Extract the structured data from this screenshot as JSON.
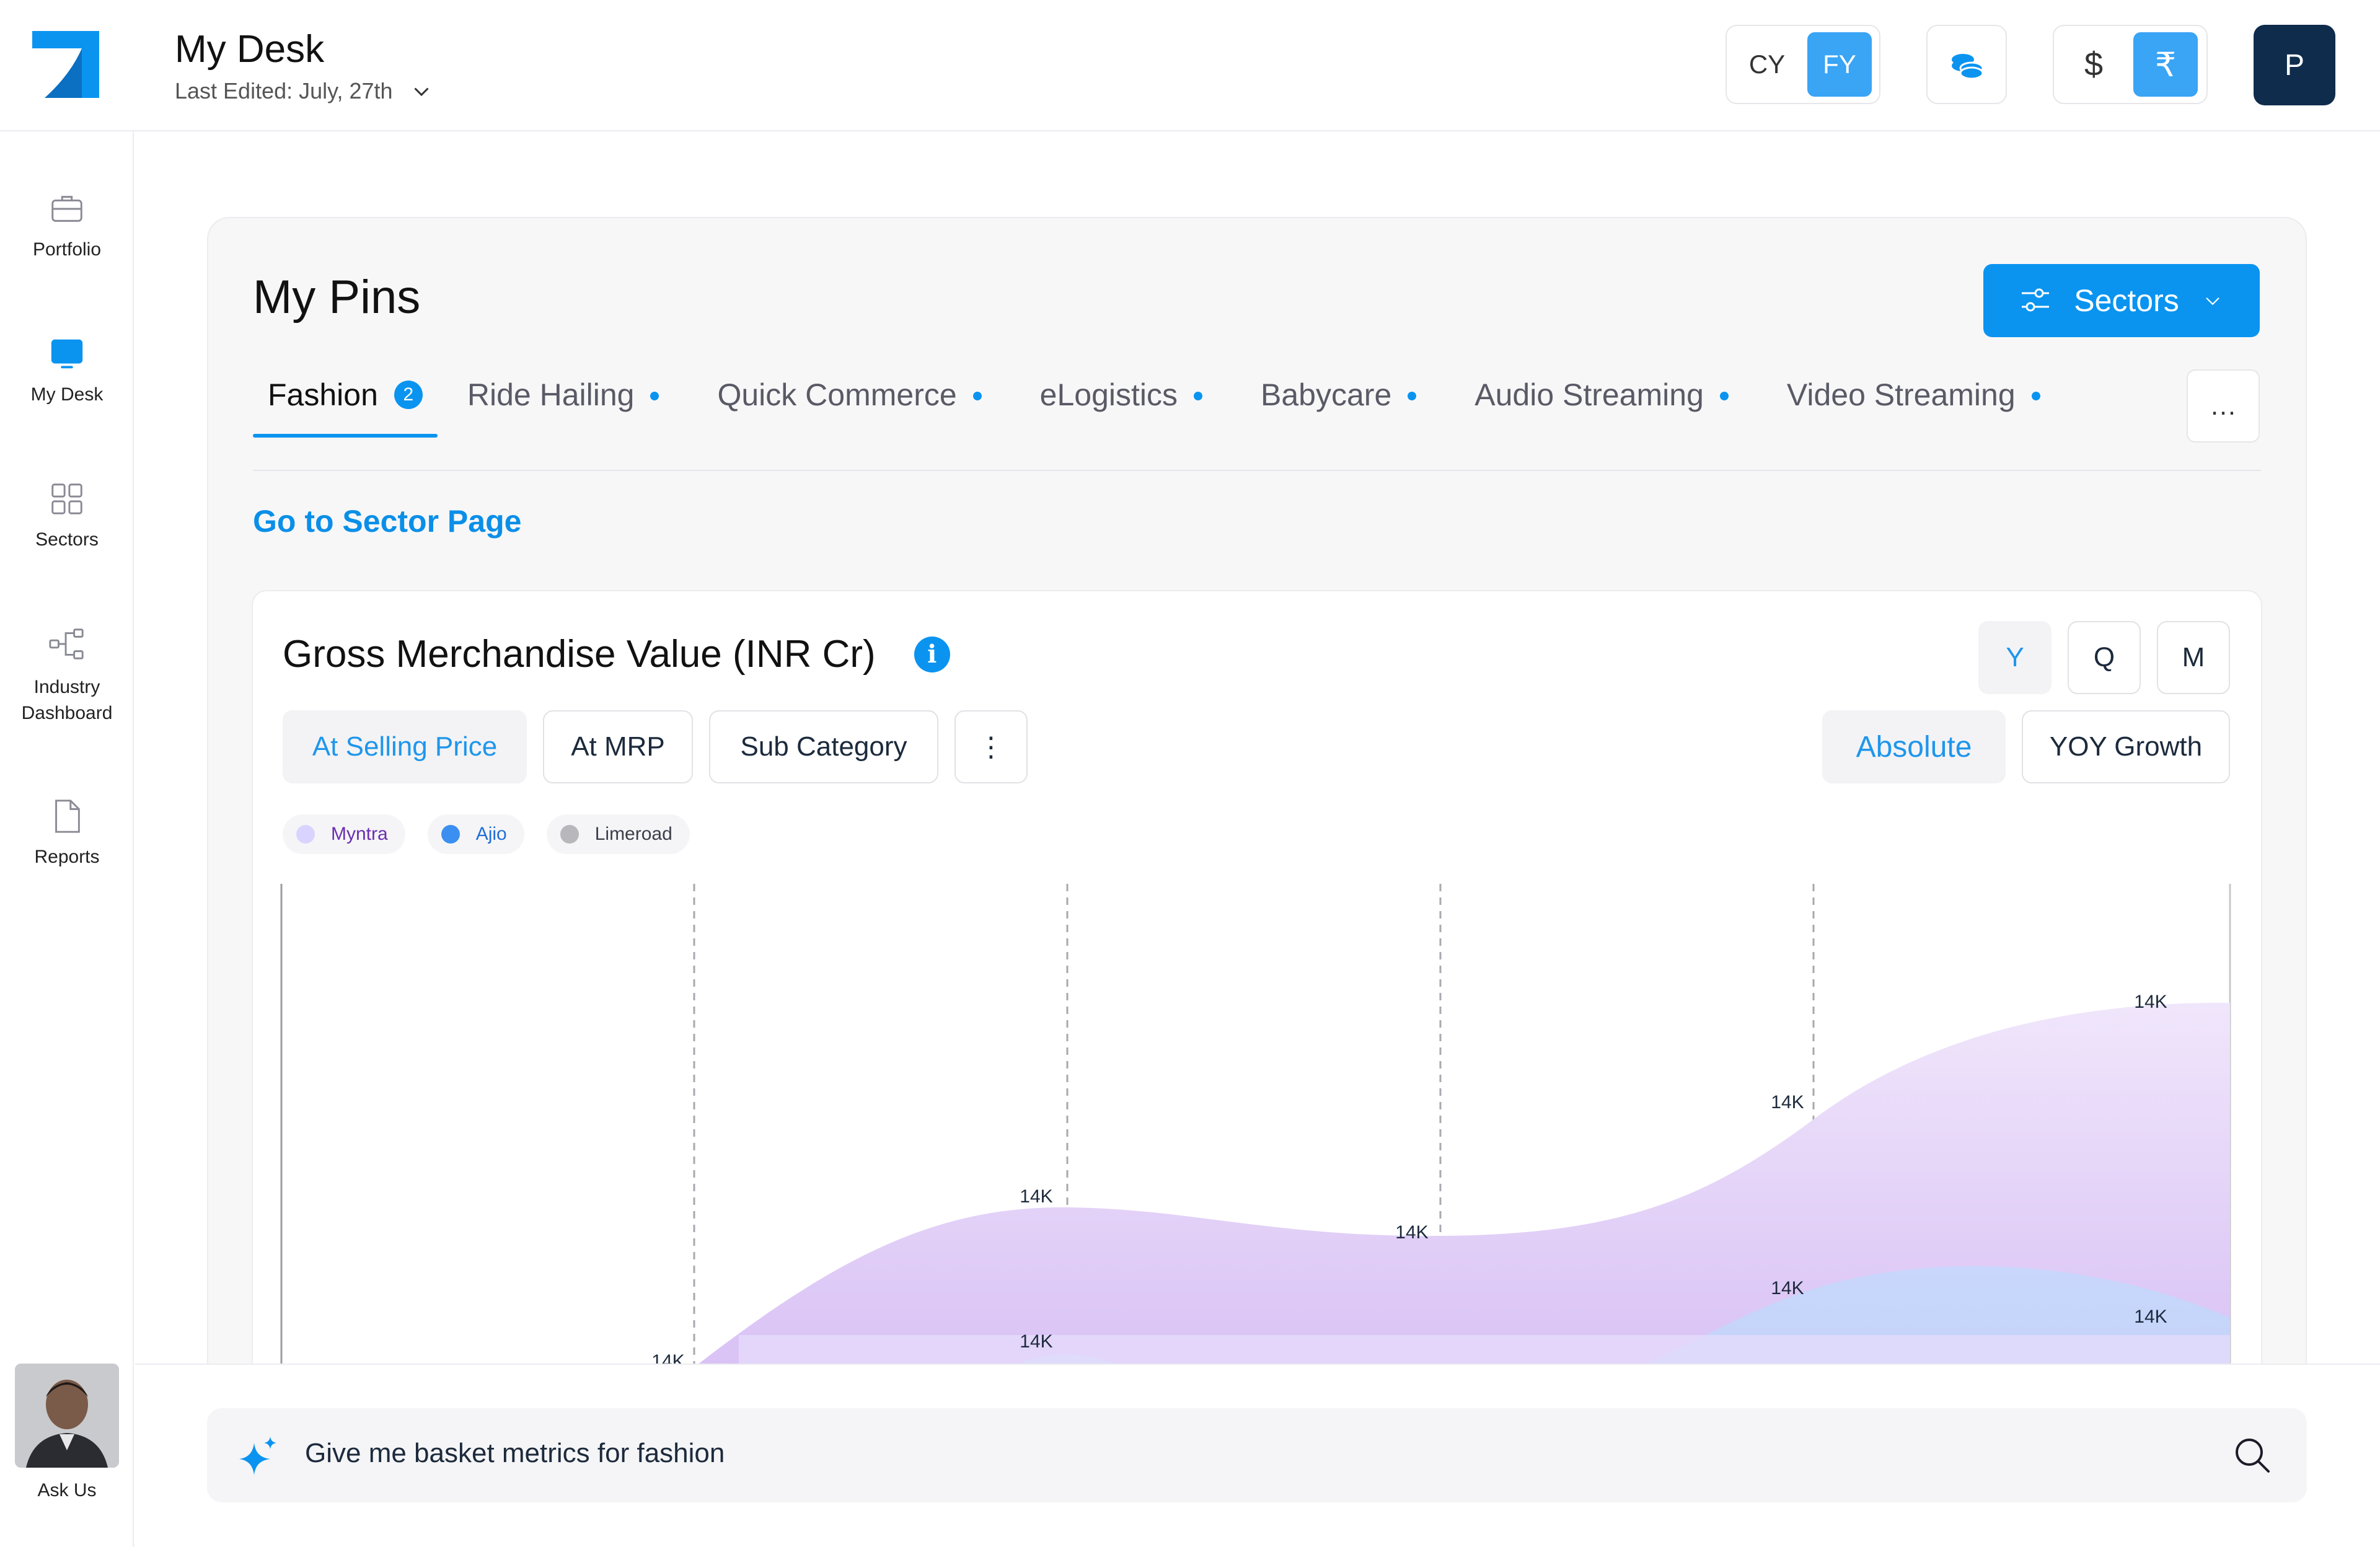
{
  "header": {
    "title": "My Desk",
    "last_edited": "Last Edited: July, 27th",
    "calendar_toggle": {
      "options": [
        "CY",
        "FY"
      ],
      "selected": "FY"
    },
    "currency_toggle": {
      "options": [
        "$",
        "₹"
      ],
      "selected": "₹"
    },
    "user_initial": "P",
    "accent_color": "#0a94f0"
  },
  "sidebar": {
    "items": [
      {
        "label": "Portfolio",
        "icon": "briefcase-icon"
      },
      {
        "label": "My Desk",
        "icon": "monitor-icon",
        "active": true
      },
      {
        "label": "Sectors",
        "icon": "grid-icon"
      },
      {
        "label": "Industry Dashboard",
        "icon": "hierarchy-icon"
      },
      {
        "label": "Reports",
        "icon": "document-icon"
      }
    ],
    "ask_label": "Ask Us"
  },
  "pins": {
    "title": "My Pins",
    "sectors_button": "Sectors",
    "tabs": [
      {
        "label": "Fashion",
        "badge": "2",
        "active": true
      },
      {
        "label": "Ride Hailing"
      },
      {
        "label": "Quick Commerce"
      },
      {
        "label": "eLogistics"
      },
      {
        "label": "Babycare"
      },
      {
        "label": "Audio Streaming"
      },
      {
        "label": "Video Streaming"
      }
    ],
    "more_label": "…",
    "goto_link": "Go to Sector Page"
  },
  "gmv": {
    "title": "Gross Merchandise Value (INR Cr)",
    "period_buttons": [
      "Y",
      "Q",
      "M"
    ],
    "period_selected": "Y",
    "price_filters": [
      "At Selling Price",
      "At MRP",
      "Sub Category"
    ],
    "price_selected": "At Selling Price",
    "more_label": "⋮",
    "mode_buttons": [
      "Absolute",
      "YOY Growth"
    ],
    "mode_selected": "Absolute"
  },
  "chart_data": {
    "type": "area",
    "series": [
      {
        "name": "Myntra",
        "color": "#cfb8f5",
        "labels": [
          "14K",
          "14K",
          "14K",
          "14K",
          "14K"
        ]
      },
      {
        "name": "Ajio",
        "color": "#3b8ff0",
        "labels": [
          "14K",
          "14K",
          "14K"
        ]
      },
      {
        "name": "Limeroad",
        "color": "#b8b8bc",
        "labels": []
      }
    ],
    "legend_text_colors": [
      "#6a2fb0",
      "#1f6fd6",
      "#3a3f4a"
    ],
    "grid": "dashed vertical"
  },
  "query_bar": {
    "text": "Give me basket metrics for fashion"
  }
}
